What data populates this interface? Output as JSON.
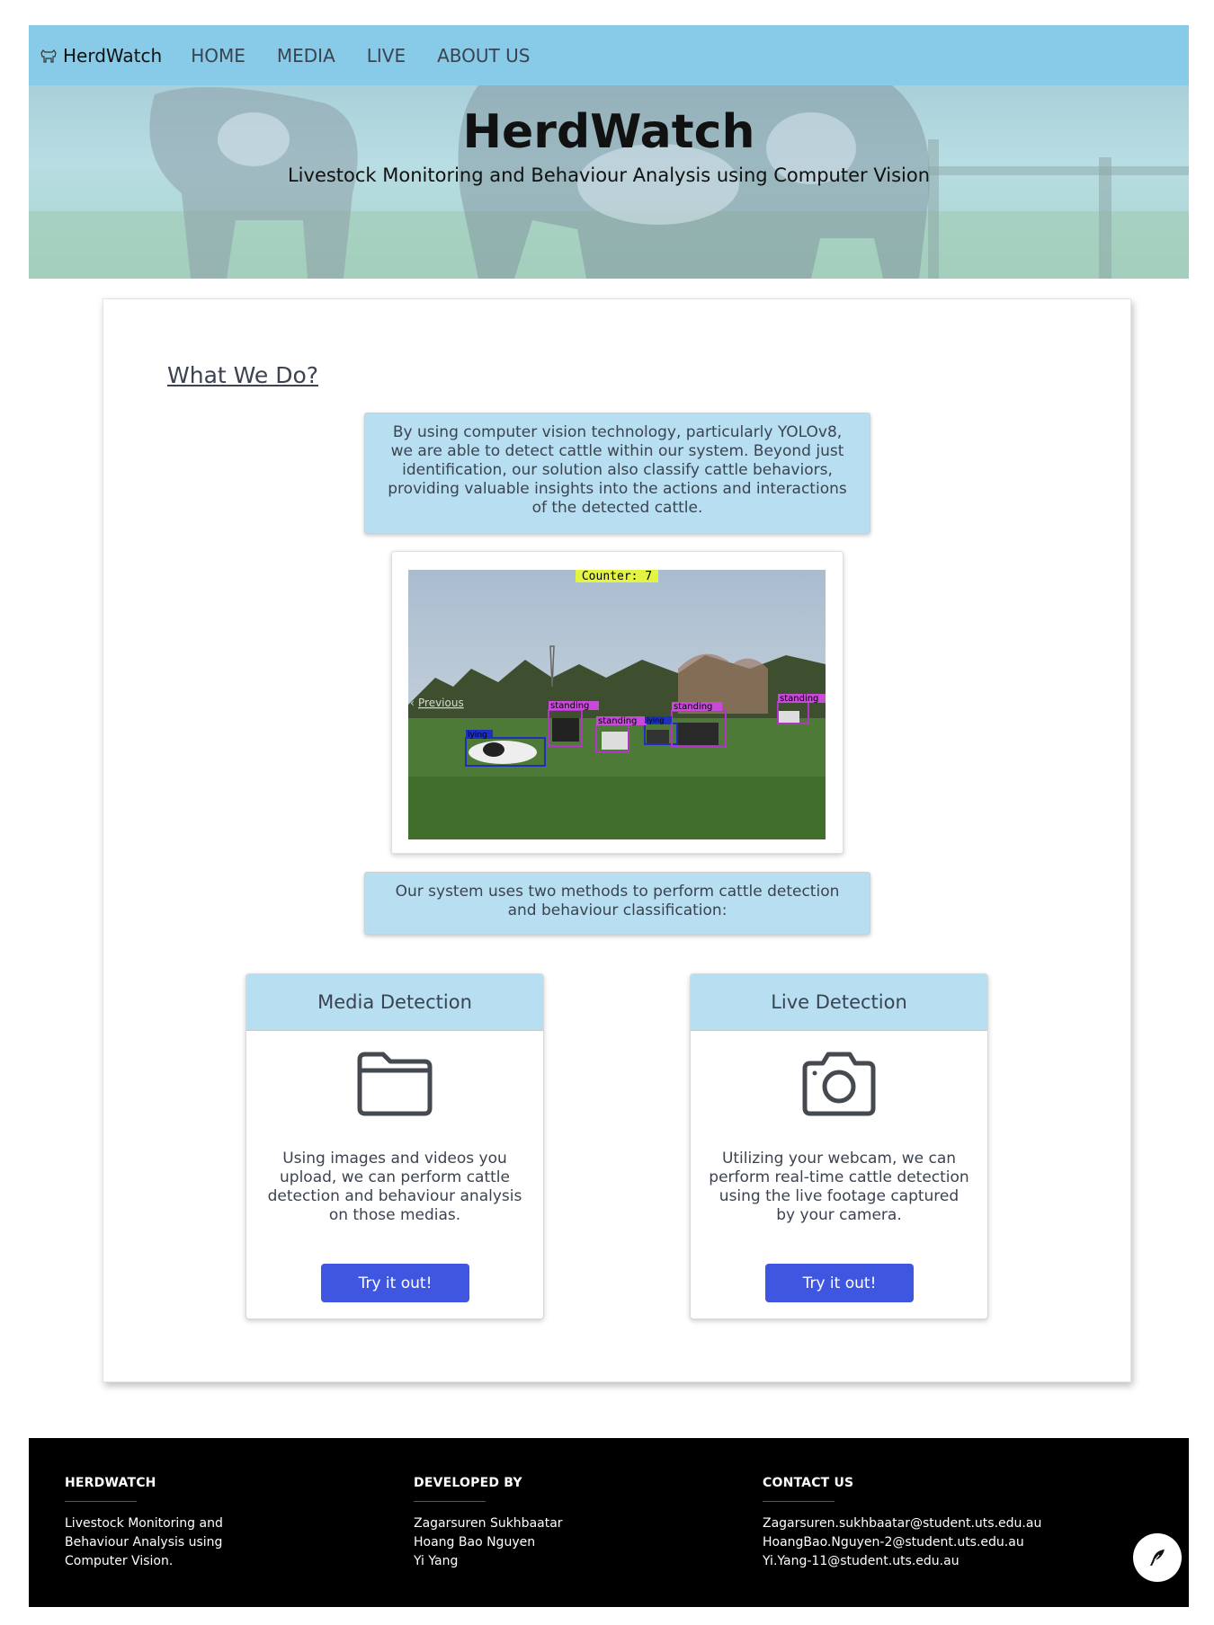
{
  "nav": {
    "brand": "HerdWatch",
    "brand_icon": "cow-icon",
    "links": [
      "HOME",
      "MEDIA",
      "LIVE",
      "ABOUT US"
    ],
    "color": "#87cbe9"
  },
  "hero": {
    "title": "HerdWatch",
    "subtitle": "Livestock Monitoring and Behaviour Analysis using Computer Vision"
  },
  "main": {
    "heading": "What We Do?",
    "intro": "By using computer vision technology, particularly YOLOv8, we are able to detect cattle within our system. Beyond just identification, our solution also classify cattle behaviors, providing valuable insights into the actions and interactions of the detected cattle.",
    "carousel": {
      "counter": "Counter: 7",
      "prev_label": "Previous",
      "detections": [
        "lying",
        "standing",
        "standing",
        "lying",
        "standing",
        "standing"
      ]
    },
    "methods_text": "Our system uses two methods to perform cattle detection and behaviour classification:",
    "cards": [
      {
        "title": "Media Detection",
        "icon": "folder-icon",
        "text": "Using images and videos you upload, we can perform cattle detection and behaviour analysis on those medias.",
        "button": "Try it out!"
      },
      {
        "title": "Live Detection",
        "icon": "camera-icon",
        "text": "Utilizing your webcam, we can perform real-time cattle detection using the live footage captured by your camera.",
        "button": "Try it out!"
      }
    ],
    "button_color": "#3f57e0"
  },
  "footer": {
    "col1": {
      "title": "HERDWATCH",
      "lines": [
        "Livestock Monitoring and",
        "Behaviour Analysis using",
        "Computer Vision."
      ]
    },
    "col2": {
      "title": "DEVELOPED BY",
      "lines": [
        "Zagarsuren Sukhbaatar",
        "Hoang Bao Nguyen",
        "Yi Yang"
      ]
    },
    "col3": {
      "title": "CONTACT US",
      "lines": [
        "Zagarsuren.sukhbaatar@student.uts.edu.au",
        "HoangBao.Nguyen-2@student.uts.edu.au",
        "Yi.Yang-11@student.uts.edu.au"
      ]
    },
    "fab_icon": "feather-icon"
  }
}
